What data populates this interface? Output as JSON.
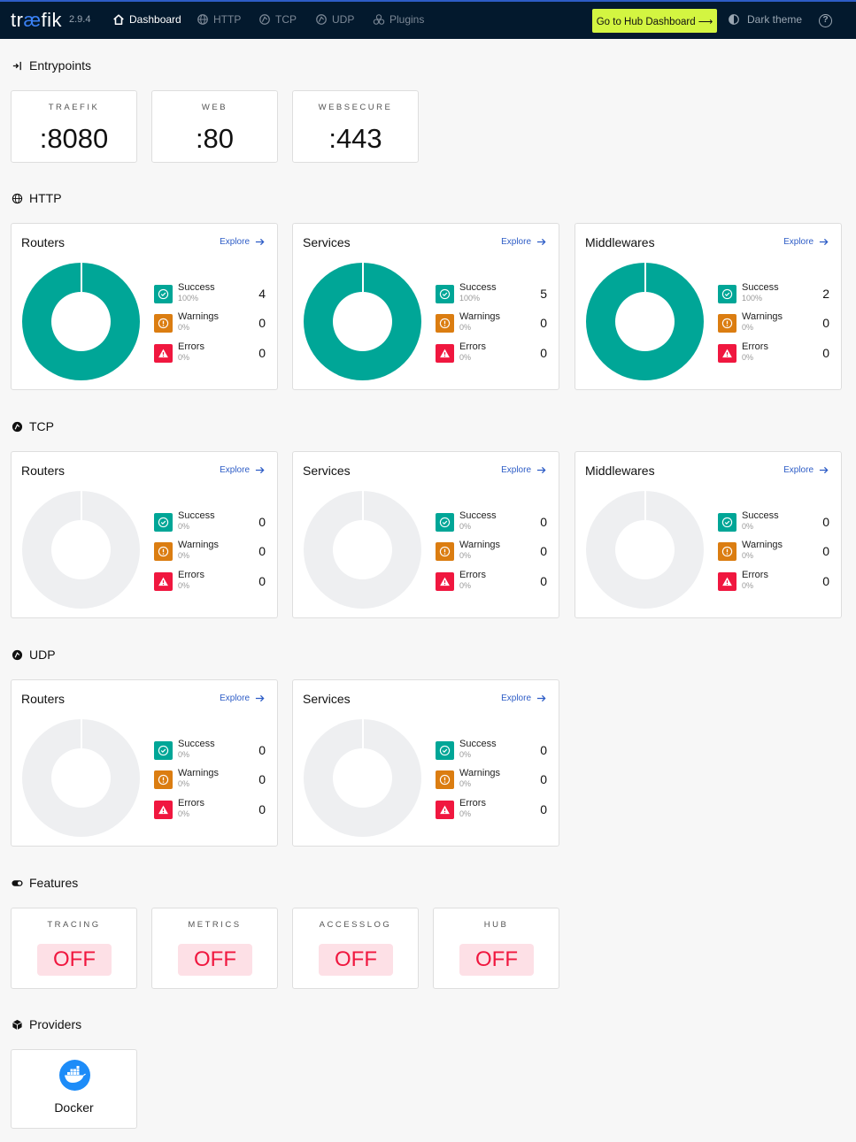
{
  "topbar": {
    "logo_left": "tr",
    "logo_ae": "æ",
    "logo_right": "fik",
    "version": "2.9.4",
    "nav": [
      {
        "label": "Dashboard",
        "icon": "home-icon",
        "active": true
      },
      {
        "label": "HTTP",
        "icon": "globe-icon",
        "active": false
      },
      {
        "label": "TCP",
        "icon": "tcp-icon",
        "active": false
      },
      {
        "label": "UDP",
        "icon": "udp-icon",
        "active": false
      },
      {
        "label": "Plugins",
        "icon": "plugins-icon",
        "active": false
      }
    ],
    "hub_button": "Go to Hub Dashboard ⟶",
    "theme_label": "Dark theme",
    "help": "?"
  },
  "entrypoints": {
    "title": "Entrypoints",
    "items": [
      {
        "name": "TRAEFIK",
        "value": ":8080"
      },
      {
        "name": "WEB",
        "value": ":80"
      },
      {
        "name": "WEBSECURE",
        "value": ":443"
      }
    ]
  },
  "http": {
    "title": "HTTP",
    "cards": [
      {
        "title": "Routers",
        "explore": "Explore",
        "stats": [
          {
            "label": "Success",
            "pct": "100%",
            "count": "4"
          },
          {
            "label": "Warnings",
            "pct": "0%",
            "count": "0"
          },
          {
            "label": "Errors",
            "pct": "0%",
            "count": "0"
          }
        ]
      },
      {
        "title": "Services",
        "explore": "Explore",
        "stats": [
          {
            "label": "Success",
            "pct": "100%",
            "count": "5"
          },
          {
            "label": "Warnings",
            "pct": "0%",
            "count": "0"
          },
          {
            "label": "Errors",
            "pct": "0%",
            "count": "0"
          }
        ]
      },
      {
        "title": "Middlewares",
        "explore": "Explore",
        "stats": [
          {
            "label": "Success",
            "pct": "100%",
            "count": "2"
          },
          {
            "label": "Warnings",
            "pct": "0%",
            "count": "0"
          },
          {
            "label": "Errors",
            "pct": "0%",
            "count": "0"
          }
        ]
      }
    ]
  },
  "tcp": {
    "title": "TCP",
    "cards": [
      {
        "title": "Routers",
        "explore": "Explore",
        "stats": [
          {
            "label": "Success",
            "pct": "0%",
            "count": "0"
          },
          {
            "label": "Warnings",
            "pct": "0%",
            "count": "0"
          },
          {
            "label": "Errors",
            "pct": "0%",
            "count": "0"
          }
        ]
      },
      {
        "title": "Services",
        "explore": "Explore",
        "stats": [
          {
            "label": "Success",
            "pct": "0%",
            "count": "0"
          },
          {
            "label": "Warnings",
            "pct": "0%",
            "count": "0"
          },
          {
            "label": "Errors",
            "pct": "0%",
            "count": "0"
          }
        ]
      },
      {
        "title": "Middlewares",
        "explore": "Explore",
        "stats": [
          {
            "label": "Success",
            "pct": "0%",
            "count": "0"
          },
          {
            "label": "Warnings",
            "pct": "0%",
            "count": "0"
          },
          {
            "label": "Errors",
            "pct": "0%",
            "count": "0"
          }
        ]
      }
    ]
  },
  "udp": {
    "title": "UDP",
    "cards": [
      {
        "title": "Routers",
        "explore": "Explore",
        "stats": [
          {
            "label": "Success",
            "pct": "0%",
            "count": "0"
          },
          {
            "label": "Warnings",
            "pct": "0%",
            "count": "0"
          },
          {
            "label": "Errors",
            "pct": "0%",
            "count": "0"
          }
        ]
      },
      {
        "title": "Services",
        "explore": "Explore",
        "stats": [
          {
            "label": "Success",
            "pct": "0%",
            "count": "0"
          },
          {
            "label": "Warnings",
            "pct": "0%",
            "count": "0"
          },
          {
            "label": "Errors",
            "pct": "0%",
            "count": "0"
          }
        ]
      }
    ]
  },
  "features": {
    "title": "Features",
    "items": [
      {
        "name": "TRACING",
        "value": "OFF"
      },
      {
        "name": "METRICS",
        "value": "OFF"
      },
      {
        "name": "ACCESSLOG",
        "value": "OFF"
      },
      {
        "name": "HUB",
        "value": "OFF"
      }
    ]
  },
  "providers": {
    "title": "Providers",
    "items": [
      {
        "name": "Docker",
        "icon": "docker-icon"
      }
    ]
  },
  "colors": {
    "topbar": "#03192d",
    "accent": "#2d5cc6",
    "hub_button": "#d3f541",
    "success": "#00a697",
    "warning": "#db7d11",
    "error": "#f0173f",
    "off_bg": "#fde0e6"
  }
}
